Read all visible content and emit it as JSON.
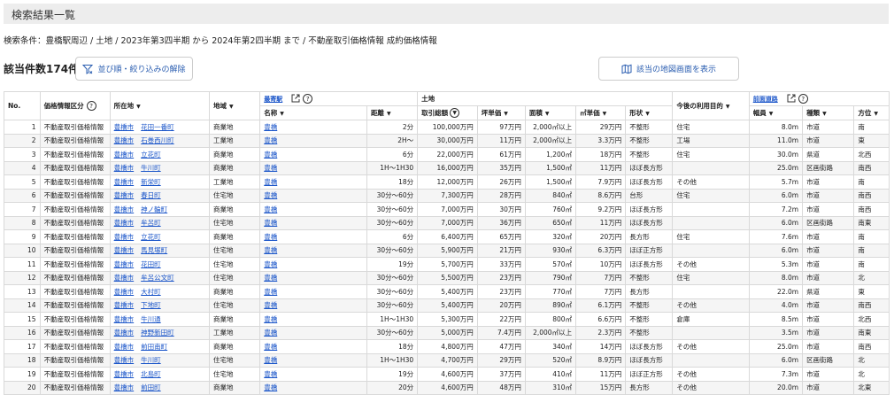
{
  "page": {
    "title": "検索結果一覧",
    "conditions": "検索条件：豊橋駅周辺 / 土地 / 2023年第3四半期 から 2024年第2四半期 まで / 不動産取引価格情報 成約価格情報",
    "count_label": "該当件数174件",
    "reset_label": "並び順・絞り込みの解除",
    "map_label": "該当の地図画面を表示"
  },
  "table": {
    "headers": {
      "no": "No.",
      "price_type": "価格情報区分",
      "location": "所在地",
      "area": "地域",
      "nearest_station": "最寄駅",
      "land": "土地",
      "future_use": "今後の利用目的",
      "front_road": "前面道路",
      "station_name": "名称",
      "distance": "距離",
      "total_price": "取引総額",
      "tsubo_price": "坪単価",
      "land_area": "面積",
      "sqm_price": "㎡単価",
      "shape": "形状",
      "road_width": "幅員",
      "road_type": "種類",
      "road_direction": "方位"
    },
    "rows": [
      {
        "no": "1",
        "type": "不動産取引価格情報",
        "city": "豊橋市",
        "town": "花田一番町",
        "area": "商業地",
        "station": "豊橋",
        "distance": "2分",
        "total": "100,000万円",
        "tsubo": "97万円",
        "size": "2,000㎡以上",
        "sqm": "29万円",
        "shape": "不整形",
        "use": "住宅",
        "width": "8.0m",
        "road": "市道",
        "dir": "南"
      },
      {
        "no": "2",
        "type": "不動産取引価格情報",
        "city": "豊橋市",
        "town": "石巻西川町",
        "area": "工業地",
        "station": "豊橋",
        "distance": "2H～",
        "total": "30,000万円",
        "tsubo": "11万円",
        "size": "2,000㎡以上",
        "sqm": "3.3万円",
        "shape": "不整形",
        "use": "工場",
        "width": "11.0m",
        "road": "市道",
        "dir": "東"
      },
      {
        "no": "3",
        "type": "不動産取引価格情報",
        "city": "豊橋市",
        "town": "立花町",
        "area": "商業地",
        "station": "豊橋",
        "distance": "6分",
        "total": "22,000万円",
        "tsubo": "61万円",
        "size": "1,200㎡",
        "sqm": "18万円",
        "shape": "不整形",
        "use": "住宅",
        "width": "30.0m",
        "road": "県道",
        "dir": "北西"
      },
      {
        "no": "4",
        "type": "不動産取引価格情報",
        "city": "豊橋市",
        "town": "牛川町",
        "area": "商業地",
        "station": "豊橋",
        "distance": "1H～1H30",
        "total": "16,000万円",
        "tsubo": "35万円",
        "size": "1,500㎡",
        "sqm": "11万円",
        "shape": "ほぼ長方形",
        "use": "",
        "width": "25.0m",
        "road": "区画街路",
        "dir": "南西"
      },
      {
        "no": "5",
        "type": "不動産取引価格情報",
        "city": "豊橋市",
        "town": "新栄町",
        "area": "工業地",
        "station": "豊橋",
        "distance": "18分",
        "total": "12,000万円",
        "tsubo": "26万円",
        "size": "1,500㎡",
        "sqm": "7.9万円",
        "shape": "ほぼ長方形",
        "use": "その他",
        "width": "5.7m",
        "road": "市道",
        "dir": "南"
      },
      {
        "no": "6",
        "type": "不動産取引価格情報",
        "city": "豊橋市",
        "town": "春日町",
        "area": "住宅地",
        "station": "豊橋",
        "distance": "30分～60分",
        "total": "7,300万円",
        "tsubo": "28万円",
        "size": "840㎡",
        "sqm": "8.6万円",
        "shape": "台形",
        "use": "住宅",
        "width": "6.0m",
        "road": "市道",
        "dir": "南西"
      },
      {
        "no": "7",
        "type": "不動産取引価格情報",
        "city": "豊橋市",
        "town": "神ノ輪町",
        "area": "商業地",
        "station": "豊橋",
        "distance": "30分～60分",
        "total": "7,000万円",
        "tsubo": "30万円",
        "size": "760㎡",
        "sqm": "9.2万円",
        "shape": "ほぼ長方形",
        "use": "",
        "width": "7.2m",
        "road": "市道",
        "dir": "南西"
      },
      {
        "no": "8",
        "type": "不動産取引価格情報",
        "city": "豊橋市",
        "town": "牟呂町",
        "area": "住宅地",
        "station": "豊橋",
        "distance": "30分～60分",
        "total": "7,000万円",
        "tsubo": "36万円",
        "size": "650㎡",
        "sqm": "11万円",
        "shape": "ほぼ長方形",
        "use": "",
        "width": "6.0m",
        "road": "区画街路",
        "dir": "南東"
      },
      {
        "no": "9",
        "type": "不動産取引価格情報",
        "city": "豊橋市",
        "town": "立花町",
        "area": "商業地",
        "station": "豊橋",
        "distance": "6分",
        "total": "6,400万円",
        "tsubo": "65万円",
        "size": "320㎡",
        "sqm": "20万円",
        "shape": "長方形",
        "use": "住宅",
        "width": "7.6m",
        "road": "市道",
        "dir": "南"
      },
      {
        "no": "10",
        "type": "不動産取引価格情報",
        "city": "豊橋市",
        "town": "馬見塚町",
        "area": "住宅地",
        "station": "豊橋",
        "distance": "30分～60分",
        "total": "5,900万円",
        "tsubo": "21万円",
        "size": "930㎡",
        "sqm": "6.3万円",
        "shape": "ほぼ正方形",
        "use": "",
        "width": "6.0m",
        "road": "市道",
        "dir": "南"
      },
      {
        "no": "11",
        "type": "不動産取引価格情報",
        "city": "豊橋市",
        "town": "花田町",
        "area": "住宅地",
        "station": "豊橋",
        "distance": "19分",
        "total": "5,700万円",
        "tsubo": "33万円",
        "size": "570㎡",
        "sqm": "10万円",
        "shape": "ほぼ長方形",
        "use": "その他",
        "width": "5.3m",
        "road": "市道",
        "dir": "南"
      },
      {
        "no": "12",
        "type": "不動産取引価格情報",
        "city": "豊橋市",
        "town": "牟呂公文町",
        "area": "住宅地",
        "station": "豊橋",
        "distance": "30分～60分",
        "total": "5,500万円",
        "tsubo": "23万円",
        "size": "790㎡",
        "sqm": "7万円",
        "shape": "不整形",
        "use": "住宅",
        "width": "8.0m",
        "road": "市道",
        "dir": "北"
      },
      {
        "no": "13",
        "type": "不動産取引価格情報",
        "city": "豊橋市",
        "town": "大村町",
        "area": "商業地",
        "station": "豊橋",
        "distance": "30分～60分",
        "total": "5,400万円",
        "tsubo": "23万円",
        "size": "770㎡",
        "sqm": "7万円",
        "shape": "長方形",
        "use": "",
        "width": "22.0m",
        "road": "県道",
        "dir": "東"
      },
      {
        "no": "14",
        "type": "不動産取引価格情報",
        "city": "豊橋市",
        "town": "下地町",
        "area": "住宅地",
        "station": "豊橋",
        "distance": "30分～60分",
        "total": "5,400万円",
        "tsubo": "20万円",
        "size": "890㎡",
        "sqm": "6.1万円",
        "shape": "不整形",
        "use": "その他",
        "width": "4.0m",
        "road": "市道",
        "dir": "南西"
      },
      {
        "no": "15",
        "type": "不動産取引価格情報",
        "city": "豊橋市",
        "town": "牛川通",
        "area": "商業地",
        "station": "豊橋",
        "distance": "1H～1H30",
        "total": "5,300万円",
        "tsubo": "22万円",
        "size": "800㎡",
        "sqm": "6.6万円",
        "shape": "不整形",
        "use": "倉庫",
        "width": "8.5m",
        "road": "市道",
        "dir": "北西"
      },
      {
        "no": "16",
        "type": "不動産取引価格情報",
        "city": "豊橋市",
        "town": "神野新田町",
        "area": "工業地",
        "station": "豊橋",
        "distance": "30分～60分",
        "total": "5,000万円",
        "tsubo": "7.4万円",
        "size": "2,000㎡以上",
        "sqm": "2.3万円",
        "shape": "不整形",
        "use": "",
        "width": "3.5m",
        "road": "市道",
        "dir": "南東"
      },
      {
        "no": "17",
        "type": "不動産取引価格情報",
        "city": "豊橋市",
        "town": "前田南町",
        "area": "商業地",
        "station": "豊橋",
        "distance": "18分",
        "total": "4,800万円",
        "tsubo": "47万円",
        "size": "340㎡",
        "sqm": "14万円",
        "shape": "ほぼ長方形",
        "use": "その他",
        "width": "25.0m",
        "road": "市道",
        "dir": "南西"
      },
      {
        "no": "18",
        "type": "不動産取引価格情報",
        "city": "豊橋市",
        "town": "牛川町",
        "area": "住宅地",
        "station": "豊橋",
        "distance": "1H～1H30",
        "total": "4,700万円",
        "tsubo": "29万円",
        "size": "520㎡",
        "sqm": "8.9万円",
        "shape": "ほぼ長方形",
        "use": "",
        "width": "6.0m",
        "road": "区画街路",
        "dir": "北"
      },
      {
        "no": "19",
        "type": "不動産取引価格情報",
        "city": "豊橋市",
        "town": "北島町",
        "area": "住宅地",
        "station": "豊橋",
        "distance": "19分",
        "total": "4,600万円",
        "tsubo": "37万円",
        "size": "410㎡",
        "sqm": "11万円",
        "shape": "ほぼ正方形",
        "use": "その他",
        "width": "7.3m",
        "road": "市道",
        "dir": "北"
      },
      {
        "no": "20",
        "type": "不動産取引価格情報",
        "city": "豊橋市",
        "town": "前田町",
        "area": "商業地",
        "station": "豊橋",
        "distance": "20分",
        "total": "4,600万円",
        "tsubo": "48万円",
        "size": "310㎡",
        "sqm": "15万円",
        "shape": "長方形",
        "use": "その他",
        "width": "20.0m",
        "road": "市道",
        "dir": "北東"
      }
    ]
  }
}
